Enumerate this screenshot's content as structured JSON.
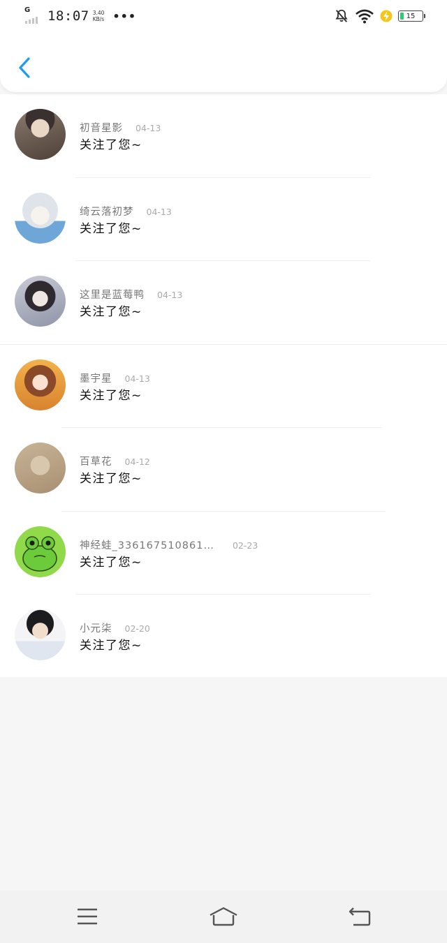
{
  "status_bar": {
    "network": "G",
    "time": "18:07",
    "speed_value": "3.40",
    "speed_unit": "KB/s",
    "more": "•••",
    "battery": "15",
    "battery_level": 0.15,
    "icons": [
      "bell-off-icon",
      "wifi-icon",
      "charging-icon",
      "battery-icon"
    ]
  },
  "header": {
    "back_icon": "chevron-left-icon",
    "accent": "#1e9bf0"
  },
  "notifications": [
    {
      "user": "初音星影",
      "date": "04-13",
      "message": "关注了您~"
    },
    {
      "user": "绮云落初梦",
      "date": "04-13",
      "message": "关注了您~"
    },
    {
      "user": "这里是蓝莓鸭",
      "date": "04-13",
      "message": "关注了您~"
    },
    {
      "user": "墨宇星",
      "date": "04-13",
      "message": "关注了您~"
    },
    {
      "user": "百草花",
      "date": "04-12",
      "message": "关注了您~"
    },
    {
      "user": "神经蛙_336167510861…",
      "date": "02-23",
      "message": "关注了您~"
    },
    {
      "user": "小元柒",
      "date": "02-20",
      "message": "关注了您~"
    }
  ],
  "nav_bar": {
    "icons": [
      "menu-icon",
      "home-icon",
      "back-icon"
    ]
  }
}
